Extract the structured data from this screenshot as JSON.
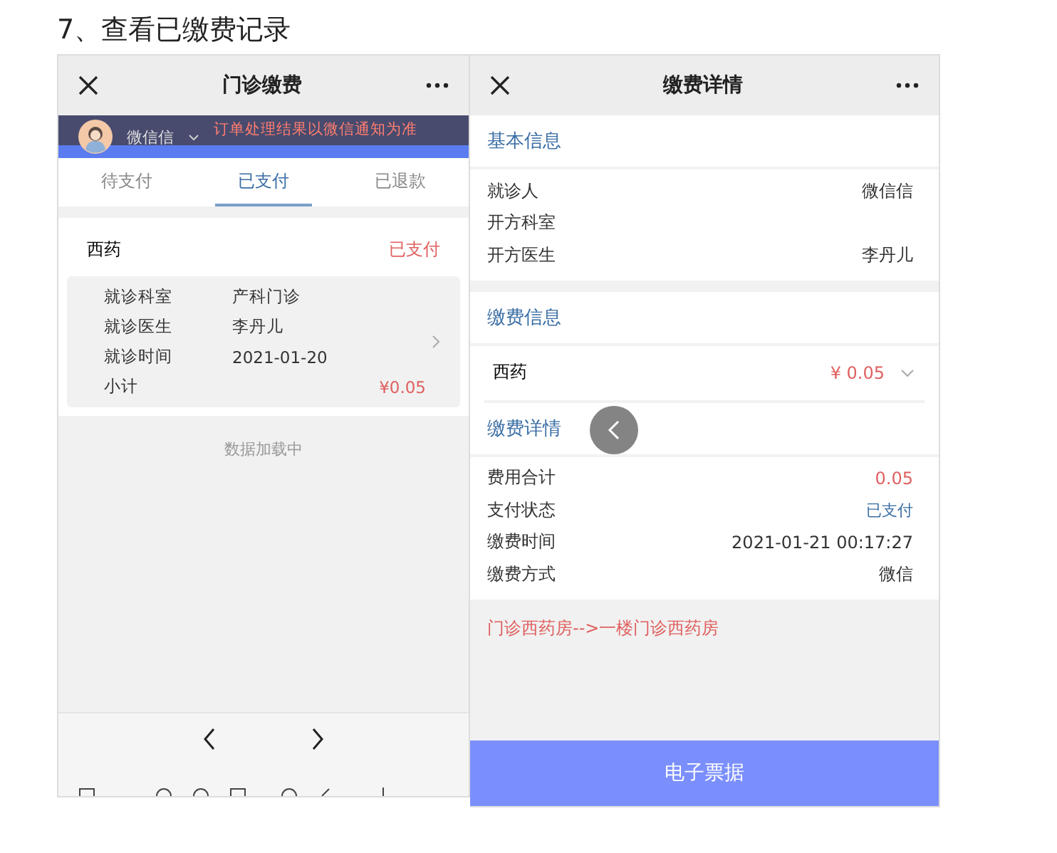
{
  "heading": "7、查看已缴费记录",
  "left_phone": {
    "title": "门诊缴费",
    "banner": {
      "user": "微信信",
      "notice": "订单处理结果以微信通知为准"
    },
    "tabs": [
      {
        "label": "待支付",
        "selected": false
      },
      {
        "label": "已支付",
        "selected": true
      },
      {
        "label": "已退款",
        "selected": false
      }
    ],
    "order": {
      "name": "西药",
      "status": "已支付",
      "rows": [
        {
          "label": "就诊科室",
          "value": "产科门诊"
        },
        {
          "label": "就诊医生",
          "value": "李丹儿"
        },
        {
          "label": "就诊时间",
          "value": "2021-01-20"
        }
      ],
      "subtotal_label": "小计",
      "subtotal": "¥0.05"
    },
    "loading": "数据加载中"
  },
  "right_phone": {
    "title": "缴费详情",
    "basic": {
      "title": "基本信息",
      "rows": [
        {
          "label": "就诊人",
          "value": "微信信"
        },
        {
          "label": "开方科室"
        },
        {
          "label": "开方医生",
          "value": "李丹儿"
        }
      ]
    },
    "payment": {
      "title": "缴费信息",
      "item": "西药",
      "amount": "¥ 0.05"
    },
    "detail": {
      "title": "缴费详情",
      "rows": [
        {
          "label": "费用合计",
          "value": "0.05",
          "kind": "amount"
        },
        {
          "label": "支付状态",
          "value": "已支付",
          "kind": "status"
        },
        {
          "label": "缴费时间",
          "value": "2021-01-21 00:17:27",
          "kind": "plain"
        },
        {
          "label": "缴费方式",
          "value": "微信",
          "kind": "plain"
        }
      ]
    },
    "pharmacy": "门诊西药房-->一楼门诊西药房",
    "button": "电子票据"
  }
}
